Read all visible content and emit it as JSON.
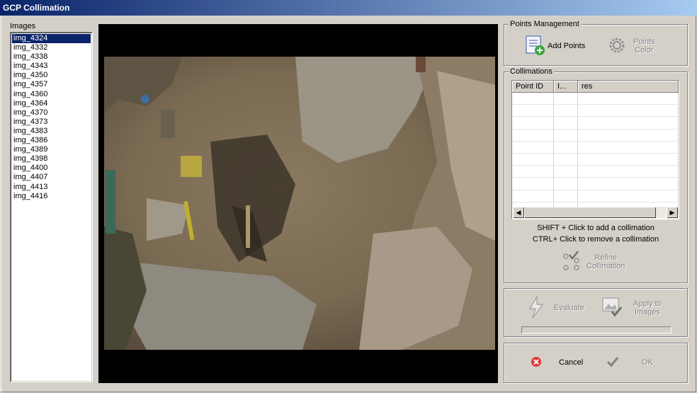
{
  "window": {
    "title": "GCP Collimation"
  },
  "images": {
    "label": "Images",
    "items": [
      "img_4324",
      "img_4332",
      "img_4338",
      "img_4343",
      "img_4350",
      "img_4357",
      "img_4360",
      "img_4364",
      "img_4370",
      "img_4373",
      "img_4383",
      "img_4386",
      "img_4389",
      "img_4398",
      "img_4400",
      "img_4407",
      "img_4413",
      "img_4416"
    ],
    "selected": "img_4324"
  },
  "points_management": {
    "title": "Points Management",
    "add_points": "Add Points",
    "points_color_line1": "Points",
    "points_color_line2": "Color"
  },
  "collimations": {
    "title": "Collimations",
    "columns": [
      "Point ID",
      "I...",
      "res"
    ],
    "hint_add": "SHIFT + Click to add a collimation",
    "hint_remove": "CTRL+ Click to remove a collimation",
    "refine_line1": "Refine",
    "refine_line2": "Collimation"
  },
  "actions": {
    "evaluate": "Evaluate",
    "apply_line1": "Apply to",
    "apply_line2": "Images",
    "progress": 0
  },
  "footer": {
    "cancel": "Cancel",
    "ok": "OK"
  }
}
